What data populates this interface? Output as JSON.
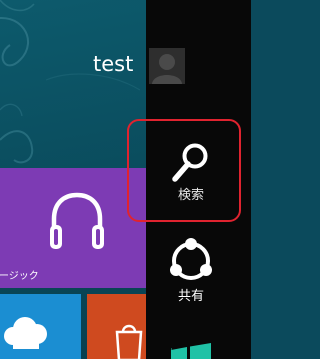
{
  "start_screen": {
    "user_name": "test",
    "tiles": {
      "music": {
        "label": "ージック",
        "color": "#7d3bb4",
        "icon": "headphones-icon"
      },
      "skydrive": {
        "color": "#1b8ed2",
        "icon": "cloud-icon"
      },
      "orange_tile": {
        "color": "#cf4a1f",
        "icon": "box-icon"
      }
    }
  },
  "charms_bar": {
    "avatar_icon": "user-avatar-icon",
    "items": [
      {
        "id": "search",
        "label": "検索",
        "icon": "search-icon",
        "highlighted": true
      },
      {
        "id": "share",
        "label": "共有",
        "icon": "share-icon"
      },
      {
        "id": "start",
        "label": "",
        "icon": "windows-logo-icon"
      }
    ]
  },
  "highlight_color": "#e0232f"
}
